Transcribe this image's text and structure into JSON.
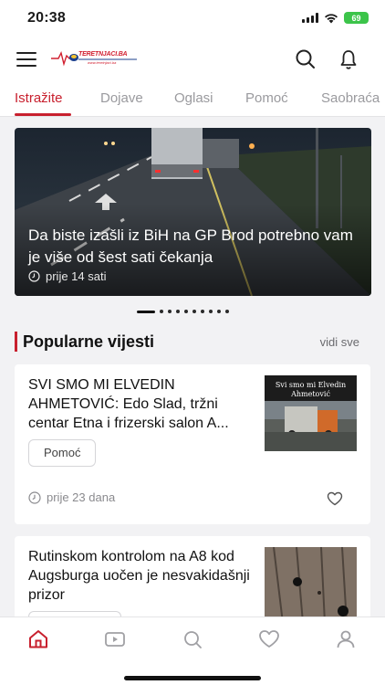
{
  "status": {
    "time": "20:38",
    "battery": "69"
  },
  "header": {
    "logo_text": "TERETNJACI.BA",
    "logo_sub": "www.teretnjaci.ba"
  },
  "tabs": [
    {
      "label": "Istražite",
      "active": true
    },
    {
      "label": "Dojave",
      "active": false
    },
    {
      "label": "Oglasi",
      "active": false
    },
    {
      "label": "Pomoć",
      "active": false
    },
    {
      "label": "Saobraća",
      "active": false
    }
  ],
  "hero": {
    "title": "Da biste izašli iz BiH na GP Brod potrebno vam je više od šest sati čekanja",
    "time": "prije 14 sati",
    "slide_count": 10,
    "active_slide": 1
  },
  "popular": {
    "title": "Popularne vijesti",
    "see_all": "vidi sve",
    "articles": [
      {
        "title": "SVI SMO MI ELVEDIN AHMETOVIĆ: Edo Slad, tržni centar Etna i frizerski salon A...",
        "tag": "Pomoć",
        "time": "prije 23 dana",
        "thumb_caption_1": "Svi smo mi Elvedin",
        "thumb_caption_2": "Ahmetović"
      },
      {
        "title": "Rutinskom kontrolom na A8 kod Augsburga uočen je nesvakidašnji prizor"
      }
    ]
  },
  "colors": {
    "accent": "#c8202e",
    "background": "#f2f2f4"
  },
  "bottom_nav": [
    "home-icon",
    "video-icon",
    "search-icon",
    "heart-icon",
    "profile-icon"
  ]
}
